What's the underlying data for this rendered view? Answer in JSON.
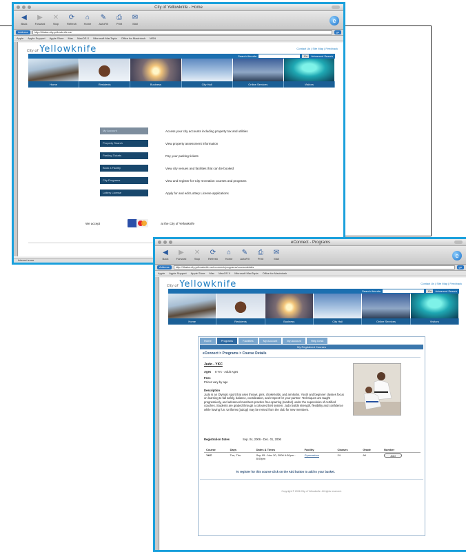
{
  "window1": {
    "title": "City of Yellowknife - Home",
    "toolbar": [
      "Back",
      "Forward",
      "Stop",
      "Refresh",
      "Home",
      "AutoFill",
      "Print",
      "Mail"
    ],
    "address": {
      "label": "Address",
      "url": "http://ithaka.city.yellowknife.ca/",
      "go": "go"
    },
    "bookmarks": [
      "Apple",
      "Apple Support",
      "Apple Store",
      "Mac",
      "MacOS X",
      "Microsoft MacTopia",
      "Office for Macintosh",
      "MSN"
    ],
    "site": {
      "city_of": "City of",
      "name": "Yellowknife",
      "header_links": "Contact Us | Site Map | Feedback",
      "search_label": "Search this site",
      "search_go": "Go",
      "advanced": "Advanced Search"
    },
    "nav": [
      "Home",
      "Residents",
      "Business",
      "City Hall",
      "Online Services",
      "Visitors"
    ],
    "services": [
      {
        "label": "My Account",
        "desc": "Access your city accounts including property tax and utilities",
        "active": true
      },
      {
        "label": "Property Search",
        "desc": "View property assessment information",
        "active": false
      },
      {
        "label": "Parking Tickets",
        "desc": "Pay your parking tickets",
        "active": false
      },
      {
        "label": "Book a Facility",
        "desc": "View city venues and facilities that can be booked",
        "active": false
      },
      {
        "label": "City Programs",
        "desc": "View and register for City recreation courses and programs",
        "active": false
      },
      {
        "label": "Lottery License",
        "desc": "Apply for and edit Lottery License applications",
        "active": false
      }
    ],
    "accept_left": "We accept",
    "accept_right": "at the City of Yellowknife",
    "status": "Internet zone"
  },
  "window2": {
    "title": "eConnect - Programs",
    "toolbar": [
      "Back",
      "Forward",
      "Stop",
      "Refresh",
      "Home",
      "AutoFill",
      "Print",
      "Mail"
    ],
    "address": {
      "label": "Address",
      "url": "http://ithaka.city.yellowknife.ca/econnect/programs/coursedetails",
      "go": "go"
    },
    "tabs": [
      "Home",
      "Programs",
      "Facilities",
      "My Account",
      "My Account",
      "Help Desk"
    ],
    "subbar": "My Registered Courses",
    "breadcrumb": "eConnect > Programs > Course Details",
    "course_title": "Judo - YKC",
    "fields": [
      {
        "label": "Ages",
        "value": "8 Yrs - Adult Ages"
      },
      {
        "label": "Fees",
        "value": "Prices vary by age"
      }
    ],
    "description_label": "Description",
    "description": "Judo is an Olympic sport that uses throws, pins, chokeholds, and armlocks. Youth and beginner classes focus on learning to fall safely, balance, coordination, and respect for your partner. Techniques are taught progressively, and advanced members practice free-sparring (randori) under the supervision of certified coaches. Students are graded through a coloured belt system. Judo builds strength, flexibility and confidence while having fun. Uniforms (judogi) may be rented from the club for new members.",
    "registration_label": "Registration Dates",
    "registration_value": "Sep. 04, 2006 - Dec. 01, 2006",
    "table": {
      "headers": [
        "Course",
        "Days",
        "Dates & Times",
        "Facility",
        "Classes",
        "Grade",
        "Number"
      ],
      "row": [
        "YKC",
        "Tue, Thu",
        "Sep 05 - Nov 30, 2006 6:30pm - 8:00pm",
        "Gymnasium",
        "24",
        "All",
        "Add"
      ]
    },
    "register_note": "To register for this course click on the Add button to add to your basket.",
    "footer": "Copyright © 2006 City of Yellowknife. All rights reserved."
  }
}
